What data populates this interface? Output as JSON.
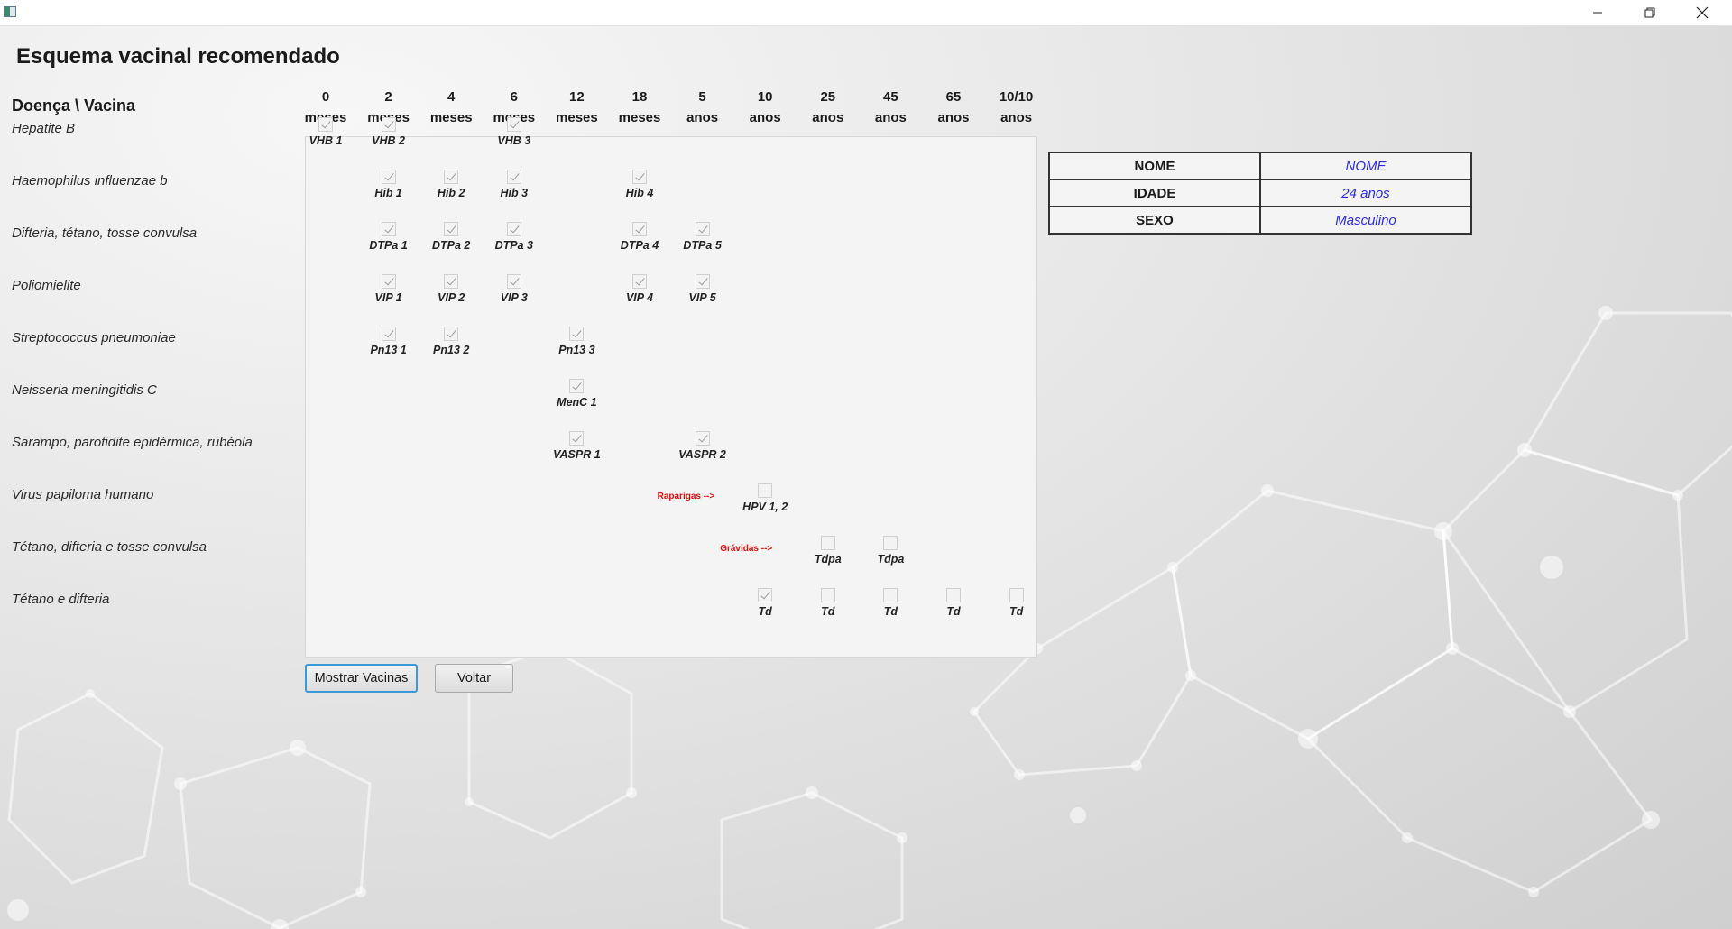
{
  "window": {
    "title": ""
  },
  "page_title": "Esquema vacinal recomendado",
  "corner_label": "Doença \\ Vacina",
  "columns": [
    {
      "num": "0",
      "unit": "meses"
    },
    {
      "num": "2",
      "unit": "meses"
    },
    {
      "num": "4",
      "unit": "meses"
    },
    {
      "num": "6",
      "unit": "meses"
    },
    {
      "num": "12",
      "unit": "meses"
    },
    {
      "num": "18",
      "unit": "meses"
    },
    {
      "num": "5",
      "unit": "anos"
    },
    {
      "num": "10",
      "unit": "anos"
    },
    {
      "num": "25",
      "unit": "anos"
    },
    {
      "num": "45",
      "unit": "anos"
    },
    {
      "num": "65",
      "unit": "anos"
    },
    {
      "num": "10/10",
      "unit": "anos"
    }
  ],
  "rows": [
    {
      "label": "Hepatite B",
      "cells": [
        {
          "col": 0,
          "label": "VHB 1",
          "checked": true
        },
        {
          "col": 1,
          "label": "VHB 2",
          "checked": true
        },
        {
          "col": 3,
          "label": "VHB 3",
          "checked": true
        }
      ]
    },
    {
      "label": "Haemophilus influenzae b",
      "cells": [
        {
          "col": 1,
          "label": "Hib 1",
          "checked": true
        },
        {
          "col": 2,
          "label": "Hib 2",
          "checked": true
        },
        {
          "col": 3,
          "label": "Hib 3",
          "checked": true
        },
        {
          "col": 5,
          "label": "Hib 4",
          "checked": true
        }
      ]
    },
    {
      "label": "Difteria, tétano, tosse convulsa",
      "cells": [
        {
          "col": 1,
          "label": "DTPa 1",
          "checked": true
        },
        {
          "col": 2,
          "label": "DTPa 2",
          "checked": true
        },
        {
          "col": 3,
          "label": "DTPa 3",
          "checked": true
        },
        {
          "col": 5,
          "label": "DTPa 4",
          "checked": true
        },
        {
          "col": 6,
          "label": "DTPa 5",
          "checked": true
        }
      ]
    },
    {
      "label": "Poliomielite",
      "cells": [
        {
          "col": 1,
          "label": "VIP 1",
          "checked": true
        },
        {
          "col": 2,
          "label": "VIP 2",
          "checked": true
        },
        {
          "col": 3,
          "label": "VIP 3",
          "checked": true
        },
        {
          "col": 5,
          "label": "VIP 4",
          "checked": true
        },
        {
          "col": 6,
          "label": "VIP 5",
          "checked": true
        }
      ]
    },
    {
      "label": "Streptococcus pneumoniae",
      "cells": [
        {
          "col": 1,
          "label": "Pn13 1",
          "checked": true
        },
        {
          "col": 2,
          "label": "Pn13 2",
          "checked": true
        },
        {
          "col": 4,
          "label": "Pn13 3",
          "checked": true
        }
      ]
    },
    {
      "label": "Neisseria meningitidis C",
      "cells": [
        {
          "col": 4,
          "label": "MenC 1",
          "checked": true
        }
      ]
    },
    {
      "label": "Sarampo, parotidite epidérmica, rubéola",
      "cells": [
        {
          "col": 4,
          "label": "VASPR 1",
          "checked": true
        },
        {
          "col": 6,
          "label": "VASPR 2",
          "checked": true
        }
      ]
    },
    {
      "label": "Virus papiloma humano",
      "note": "Raparigas -->",
      "cells": [
        {
          "col": 7,
          "label": "HPV 1, 2",
          "checked": false
        }
      ]
    },
    {
      "label": "Tétano, difteria e tosse convulsa",
      "note": "Grávidas -->",
      "cells": [
        {
          "col": 8,
          "label": "Tdpa",
          "checked": false
        },
        {
          "col": 9,
          "label": "Tdpa",
          "checked": false
        }
      ]
    },
    {
      "label": "Tétano e difteria",
      "cells": [
        {
          "col": 7,
          "label": "Td",
          "checked": true
        },
        {
          "col": 8,
          "label": "Td",
          "checked": false
        },
        {
          "col": 9,
          "label": "Td",
          "checked": false
        },
        {
          "col": 10,
          "label": "Td",
          "checked": false
        },
        {
          "col": 11,
          "label": "Td",
          "checked": false
        }
      ]
    }
  ],
  "info": {
    "rows": [
      {
        "key": "NOME",
        "value": "NOME"
      },
      {
        "key": "IDADE",
        "value": "24 anos"
      },
      {
        "key": "SEXO",
        "value": "Masculino"
      }
    ]
  },
  "buttons": {
    "show": "Mostrar Vacinas",
    "back": "Voltar"
  },
  "colors": {
    "note": "#e01010",
    "info_value": "#2a2ae0",
    "focus": "#3a9ad9"
  },
  "icons": {
    "minimize": "minimize-icon",
    "restore": "restore-icon",
    "close": "close-icon"
  }
}
